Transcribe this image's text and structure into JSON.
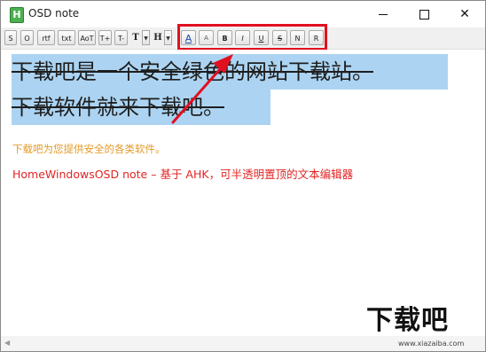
{
  "window": {
    "title": "OSD note",
    "app_icon": "H"
  },
  "toolbar": {
    "buttons": [
      "S",
      "O",
      "rtf",
      "txt",
      "AoT",
      "T+",
      "T-",
      "T",
      "H",
      "A",
      "A",
      "B",
      "I",
      "U",
      "S",
      "N",
      "R"
    ]
  },
  "editor": {
    "line1": "下载吧是一个安全绿色的网站下载站。",
    "line2": "下载软件就来下载吧。",
    "orange_line": "下载吧为您提供安全的各类软件。",
    "red_line": "HomeWindowsOSD note – 基于 AHK，可半透明置顶的文本编辑器"
  },
  "colors": {
    "selection": "#acd4f2",
    "orange_text": "#e39b28",
    "red_text": "#e22424",
    "highlight_box": "#e01020"
  },
  "watermark": {
    "logo": "下载吧",
    "url": "www.xiazaiba.com"
  }
}
